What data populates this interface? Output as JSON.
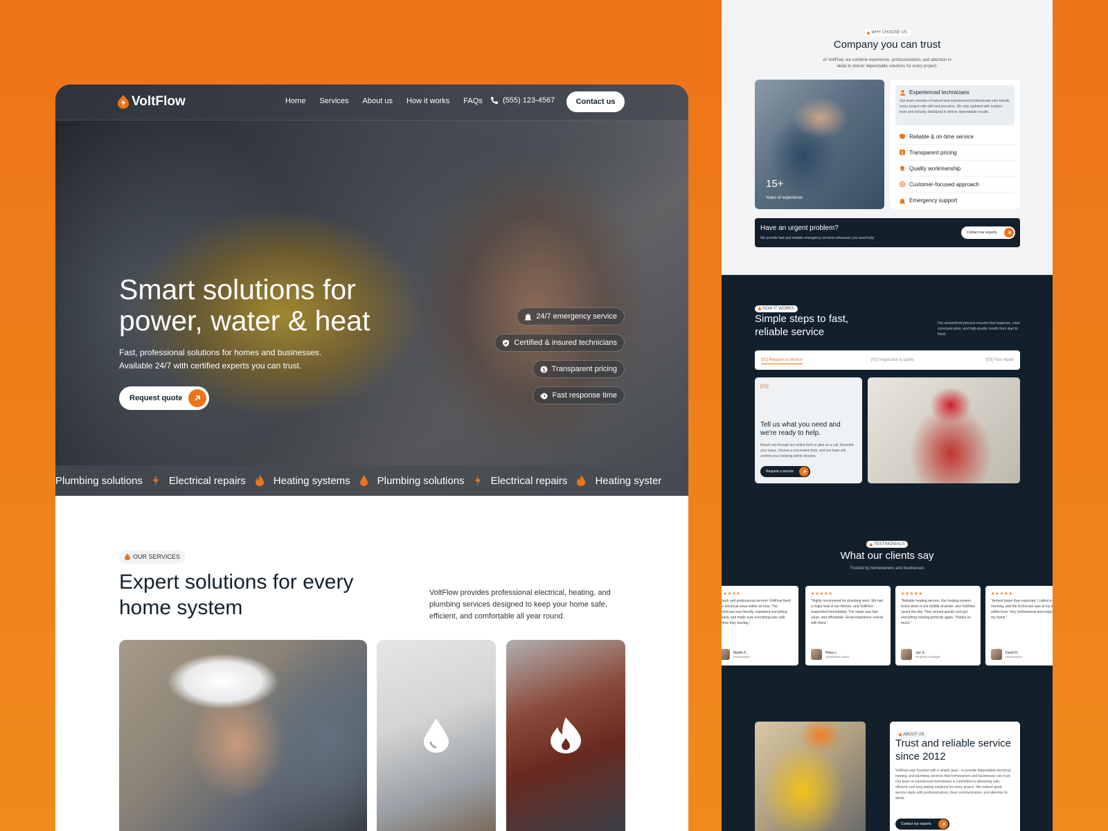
{
  "colors": {
    "accent": "#ee7418",
    "dark": "#12202c",
    "light": "#f2f4f6",
    "background": "#f08a1c"
  },
  "nav": {
    "logo": "VoltFlow",
    "links": [
      "Home",
      "Services",
      "About us",
      "How it works",
      "FAQs"
    ],
    "phone": "(555) 123-4567",
    "contact_label": "Contact us"
  },
  "hero": {
    "title": "Smart solutions for power, water & heat",
    "subtitle": "Fast, professional solutions for homes and businesses. Available 24/7 with certified experts you can trust.",
    "cta_label": "Request quote",
    "badges": [
      {
        "label": "24/7 emergency service",
        "icon": "alarm-icon"
      },
      {
        "label": "Certified & insured technicians",
        "icon": "shield-check-icon"
      },
      {
        "label": "Transparent pricing",
        "icon": "dollar-icon"
      },
      {
        "label": "Fast response time",
        "icon": "timer-icon"
      }
    ]
  },
  "ticker": {
    "items": [
      "Plumbing solutions",
      "Electrical repairs",
      "Heating systems",
      "Plumbing solutions",
      "Electrical repairs",
      "Heating syster"
    ]
  },
  "services": {
    "tag": "OUR SERVICES",
    "title": "Expert solutions for every home system",
    "description": "VoltFlow provides professional electrical, heating, and plumbing services designed to keep your home safe, efficient, and comfortable all year round."
  },
  "why": {
    "tag": "WHY CHOOSE US",
    "title": "Company you can trust",
    "subtitle": "At VoltFlow, we combine experience, professionalism, and attention to detail to deliver dependable solutions for every project.",
    "years_value": "15+",
    "years_label": "Years of experience",
    "feature_main": {
      "title": "Experienced technicians",
      "desc": "Our team consists of trained and experienced professionals who handle every project with skill and precision. We stay updated with modern tools and industry standards to deliver dependable results."
    },
    "features": [
      "Reliable & on-time service",
      "Transparent pricing",
      "Quality workmanship",
      "Customer-focused approach",
      "Emergency support"
    ]
  },
  "urgent": {
    "title": "Have an urgent problem?",
    "subtitle": "We provide fast and reliable emergency services whenever you need help.",
    "button": "Contact our experts"
  },
  "how": {
    "tag": "HOW IT WORKS",
    "title": "Simple steps to fast, reliable service",
    "description": "Our streamlined process ensures fast response, clear communication, and high-quality results from start to finish.",
    "steps": [
      "[01] Request a service",
      "[02] Inspection & quote",
      "[03] Fast repair"
    ],
    "card": {
      "num": "[01]",
      "title": "Tell us what you need and we're ready to help.",
      "desc": "Reach out through our online form or give us a call. Describe your issue, choose a convenient time, and our team will confirm your booking within minutes.",
      "button": "Request a service"
    }
  },
  "testimonials": {
    "tag": "TESTIMONIALS",
    "title": "What our clients say",
    "subtitle": "Trusted by homeowners and businesses",
    "rating": 5,
    "stars": "★★★★★",
    "items": [
      {
        "quote": "\"Quick and professional service! VoltFlow fixed our electrical issue within an hour. The technician was friendly, explained everything clearly, and made sure everything was safe before they leaving.\"",
        "name": "Martin K.",
        "role": "Homeowner"
      },
      {
        "quote": "\"Highly recommend for plumbing work. We had a major leak in our kitchen, and VoltFlow responded immediately. The repair was fast, clean, and affordable. Great experience overall with them.\"",
        "name": "Petra L.",
        "role": "Apartment owner"
      },
      {
        "quote": "\"Reliable heating service. Our heating system broke down in the middle of winter, and VoltFlow saved the day. They arrived quickly and got everything running perfectly again. Thanks so much.\"",
        "name": "Jan S.",
        "role": "Property manager"
      },
      {
        "quote": "\"Arrived faster than expected. I called in the morning, and the technician was at my door within hour. Very professional and respectful of my home.\"",
        "name": "David K.",
        "role": "Homeowner"
      }
    ]
  },
  "about": {
    "tag": "ABOUT US",
    "title": "Trust and reliable service since 2012",
    "desc": "VoltFlow was founded with a simple goal – to provide dependable electrical, heating, and plumbing services that homeowners and businesses can trust. Our team of experienced technicians is committed to delivering safe, efficient, and long-lasting solutions for every project. We believe great service starts with professionalism, clear communication, and attention to detail.",
    "button": "Contact our experts"
  }
}
